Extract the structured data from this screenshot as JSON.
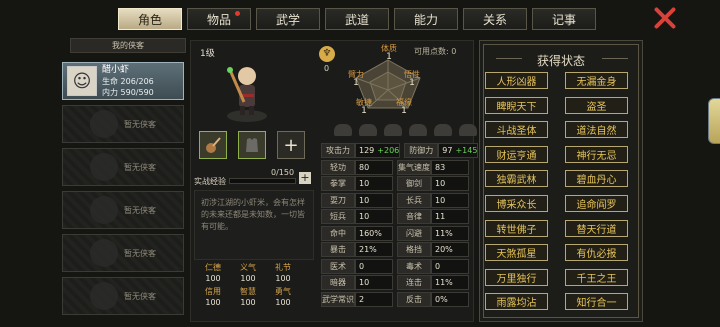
{
  "tabs": [
    {
      "label": "角色",
      "active": true,
      "dot": false
    },
    {
      "label": "物品",
      "active": false,
      "dot": true
    },
    {
      "label": "武学",
      "active": false,
      "dot": false
    },
    {
      "label": "武道",
      "active": false,
      "dot": false
    },
    {
      "label": "能力",
      "active": false,
      "dot": false
    },
    {
      "label": "关系",
      "active": false,
      "dot": false
    },
    {
      "label": "记事",
      "active": false,
      "dot": false
    }
  ],
  "left": {
    "header": "我的侠客",
    "selected": {
      "name": "醋小虾",
      "hp": "生命 206/206",
      "mp": "内力 590/590"
    },
    "empty_label": "暂无侠客"
  },
  "character": {
    "level": "1级",
    "coin_value": "0",
    "points": "可用点数: 0",
    "xp_label": "实战经验",
    "xp_value": "0/150",
    "xp_fraction": 0.0,
    "description": "初涉江湖的小虾米，会有怎样的未来还都是未知数，一切皆有可能。",
    "radar": [
      {
        "k": "体质",
        "v": "1"
      },
      {
        "k": "臂力",
        "v": "1"
      },
      {
        "k": "悟性",
        "v": "1"
      },
      {
        "k": "敏捷",
        "v": "1"
      },
      {
        "k": "福缘",
        "v": "1"
      }
    ],
    "virtues": [
      {
        "k": "仁德",
        "v": "100"
      },
      {
        "k": "义气",
        "v": "100"
      },
      {
        "k": "礼节",
        "v": "100"
      },
      {
        "k": "信用",
        "v": "100"
      },
      {
        "k": "智慧",
        "v": "100"
      },
      {
        "k": "勇气",
        "v": "100"
      }
    ]
  },
  "stats": [
    [
      {
        "k": "攻击力",
        "v": "129",
        "b": "+206"
      },
      {
        "k": "防御力",
        "v": "97",
        "b": "+145"
      }
    ],
    [
      {
        "k": "轻功",
        "v": "80",
        "b": ""
      },
      {
        "k": "集气速度",
        "v": "83",
        "b": ""
      }
    ],
    [
      {
        "k": "拳掌",
        "v": "10",
        "b": ""
      },
      {
        "k": "御剑",
        "v": "10",
        "b": ""
      }
    ],
    [
      {
        "k": "耍刀",
        "v": "10",
        "b": ""
      },
      {
        "k": "长兵",
        "v": "10",
        "b": ""
      }
    ],
    [
      {
        "k": "短兵",
        "v": "10",
        "b": ""
      },
      {
        "k": "音律",
        "v": "11",
        "b": ""
      }
    ],
    [
      {
        "k": "命中",
        "v": "160%",
        "b": ""
      },
      {
        "k": "闪避",
        "v": "11%",
        "b": ""
      }
    ],
    [
      {
        "k": "暴击",
        "v": "21%",
        "b": ""
      },
      {
        "k": "格挡",
        "v": "20%",
        "b": ""
      }
    ],
    [
      {
        "k": "医术",
        "v": "0",
        "b": ""
      },
      {
        "k": "毒术",
        "v": "0",
        "b": ""
      }
    ],
    [
      {
        "k": "暗器",
        "v": "10",
        "b": ""
      },
      {
        "k": "连击",
        "v": "11%",
        "b": ""
      }
    ],
    [
      {
        "k": "武学常识",
        "v": "2",
        "b": ""
      },
      {
        "k": "反击",
        "v": "0%",
        "b": ""
      }
    ]
  ],
  "status": {
    "title": "获得状态",
    "items": [
      "人形凶器",
      "无漏金身",
      "睥睨天下",
      "盗圣",
      "斗战圣体",
      "道法自然",
      "财运亨通",
      "神行无忌",
      "独霸武林",
      "碧血丹心",
      "博采众长",
      "追命阎罗",
      "转世佛子",
      "替天行道",
      "天煞孤星",
      "有仇必报",
      "万里独行",
      "千王之王",
      "雨露均沾",
      "知行合一"
    ]
  }
}
